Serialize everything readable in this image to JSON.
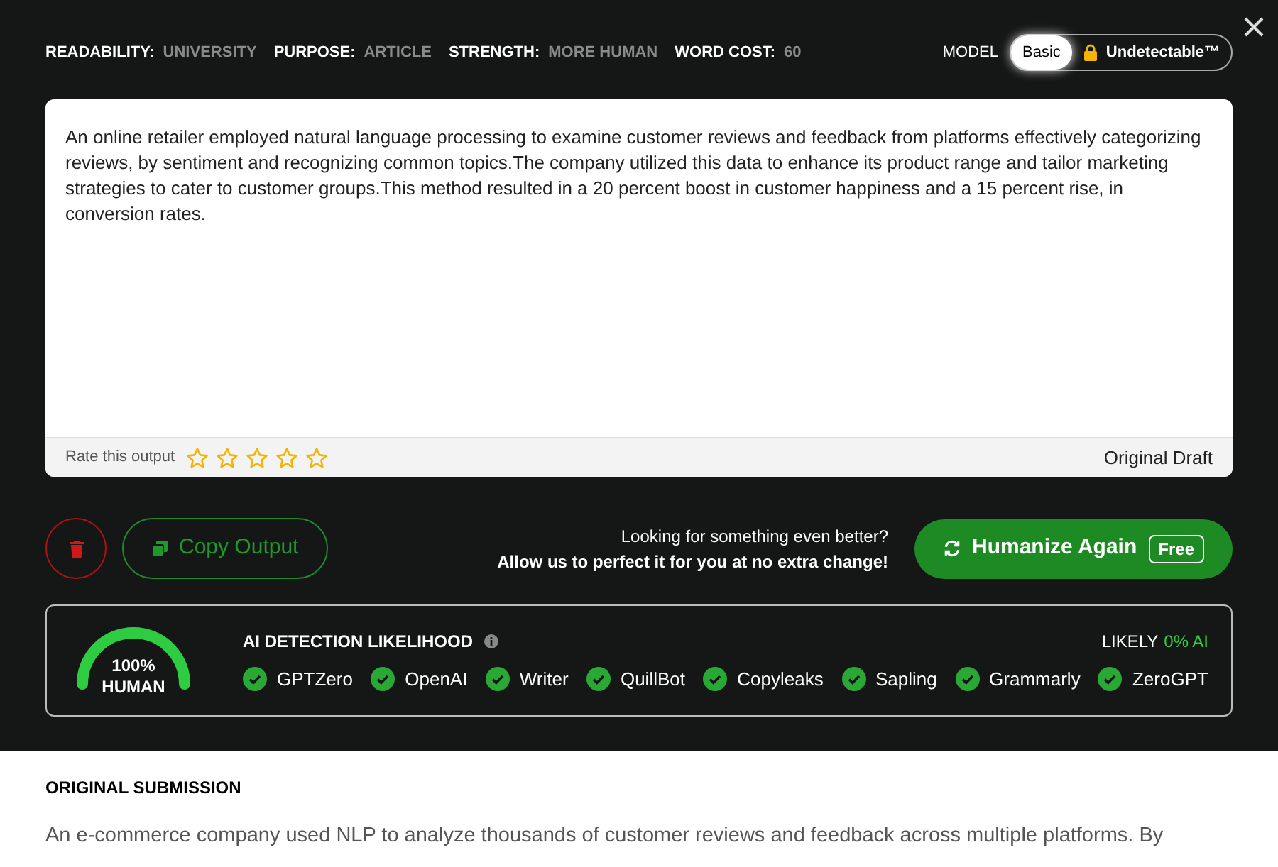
{
  "settings": [
    {
      "label": "READABILITY:",
      "value": "UNIVERSITY"
    },
    {
      "label": "PURPOSE:",
      "value": "ARTICLE"
    },
    {
      "label": "STRENGTH:",
      "value": "MORE HUMAN"
    },
    {
      "label": "WORD COST:",
      "value": "60"
    }
  ],
  "model": {
    "label": "MODEL",
    "options": [
      {
        "label": "Basic",
        "selected": true,
        "locked": false
      },
      {
        "label": "Undetectable™",
        "selected": false,
        "locked": true
      }
    ]
  },
  "output": {
    "text": "An online retailer employed natural language processing to examine customer reviews and feedback from platforms effectively categorizing reviews, by sentiment and recognizing common topics.The company utilized this data to enhance its product range and tailor marketing strategies to cater to customer groups.This method resulted in a 20 percent boost in customer happiness and a 15 percent rise, in conversion rates.",
    "rate_label": "Rate this output",
    "stars": 0,
    "draft_label": "Original Draft"
  },
  "actions": {
    "copy": "Copy Output",
    "promo_line1": "Looking for something even better?",
    "promo_line2": "Allow us to perfect it for you at no extra change!",
    "humanize": "Humanize Again",
    "badge": "Free"
  },
  "detection": {
    "gauge_value": "100%",
    "gauge_label": "HUMAN",
    "level": 1,
    "title": "AI DETECTION LIKELIHOOD",
    "likely_label": "LIKELY",
    "likely_value": "0% AI",
    "detectors": [
      {
        "name": "GPTZero",
        "passed": true
      },
      {
        "name": "OpenAI",
        "passed": true
      },
      {
        "name": "Writer",
        "passed": true
      },
      {
        "name": "QuillBot",
        "passed": true
      },
      {
        "name": "Copyleaks",
        "passed": true
      },
      {
        "name": "Sapling",
        "passed": true
      },
      {
        "name": "Grammarly",
        "passed": true
      },
      {
        "name": "ZeroGPT",
        "passed": true
      }
    ]
  },
  "original": {
    "title": "ORIGINAL SUBMISSION",
    "text": "An e-commerce company used NLP to analyze thousands of customer reviews and feedback across multiple platforms. By"
  }
}
